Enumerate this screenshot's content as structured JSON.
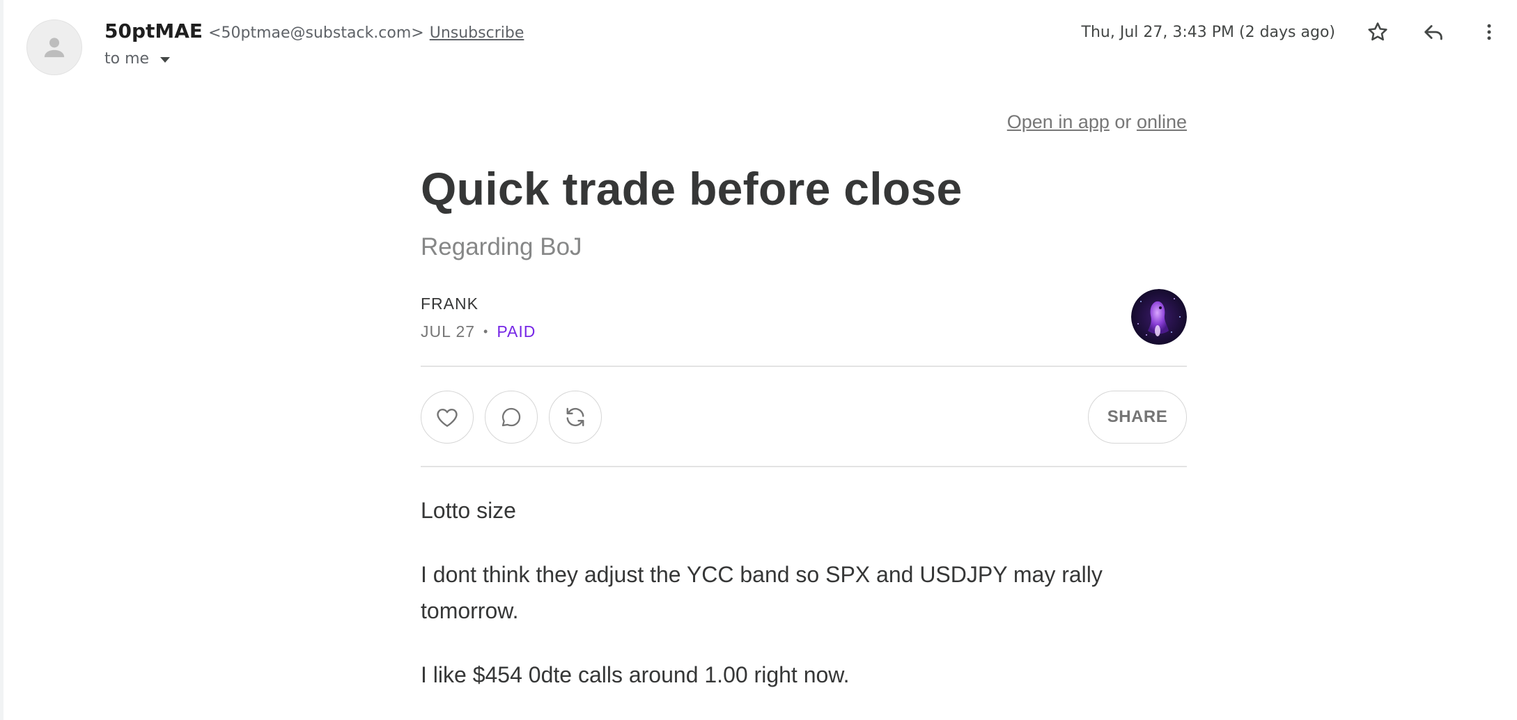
{
  "email": {
    "sender_name": "50ptMAE",
    "sender_email": "<50ptmae@substack.com>",
    "unsubscribe_label": "Unsubscribe",
    "to_label": "to me",
    "timestamp": "Thu, Jul 27, 3:43 PM (2 days ago)",
    "icons": [
      "person-icon",
      "star-icon",
      "reply-icon",
      "more-vert-icon",
      "chevron-down-icon"
    ]
  },
  "post": {
    "open_in_app": "Open in app",
    "or_text": "or",
    "online": "online",
    "title": "Quick trade before close",
    "subtitle": "Regarding BoJ",
    "author": "FRANK",
    "date": "JUL 27",
    "separator": "•",
    "paid_label": "PAID",
    "share_label": "SHARE",
    "action_icons": [
      "heart-icon",
      "comment-icon",
      "restack-icon"
    ],
    "paragraphs": [
      "Lotto size",
      "I dont think they adjust the YCC band so SPX and USDJPY may rally tomorrow.",
      "I like $454 0dte calls around 1.00 right now."
    ]
  },
  "colors": {
    "paid_accent": "#7627e6",
    "title_text": "#363737",
    "muted_text": "#777777"
  }
}
